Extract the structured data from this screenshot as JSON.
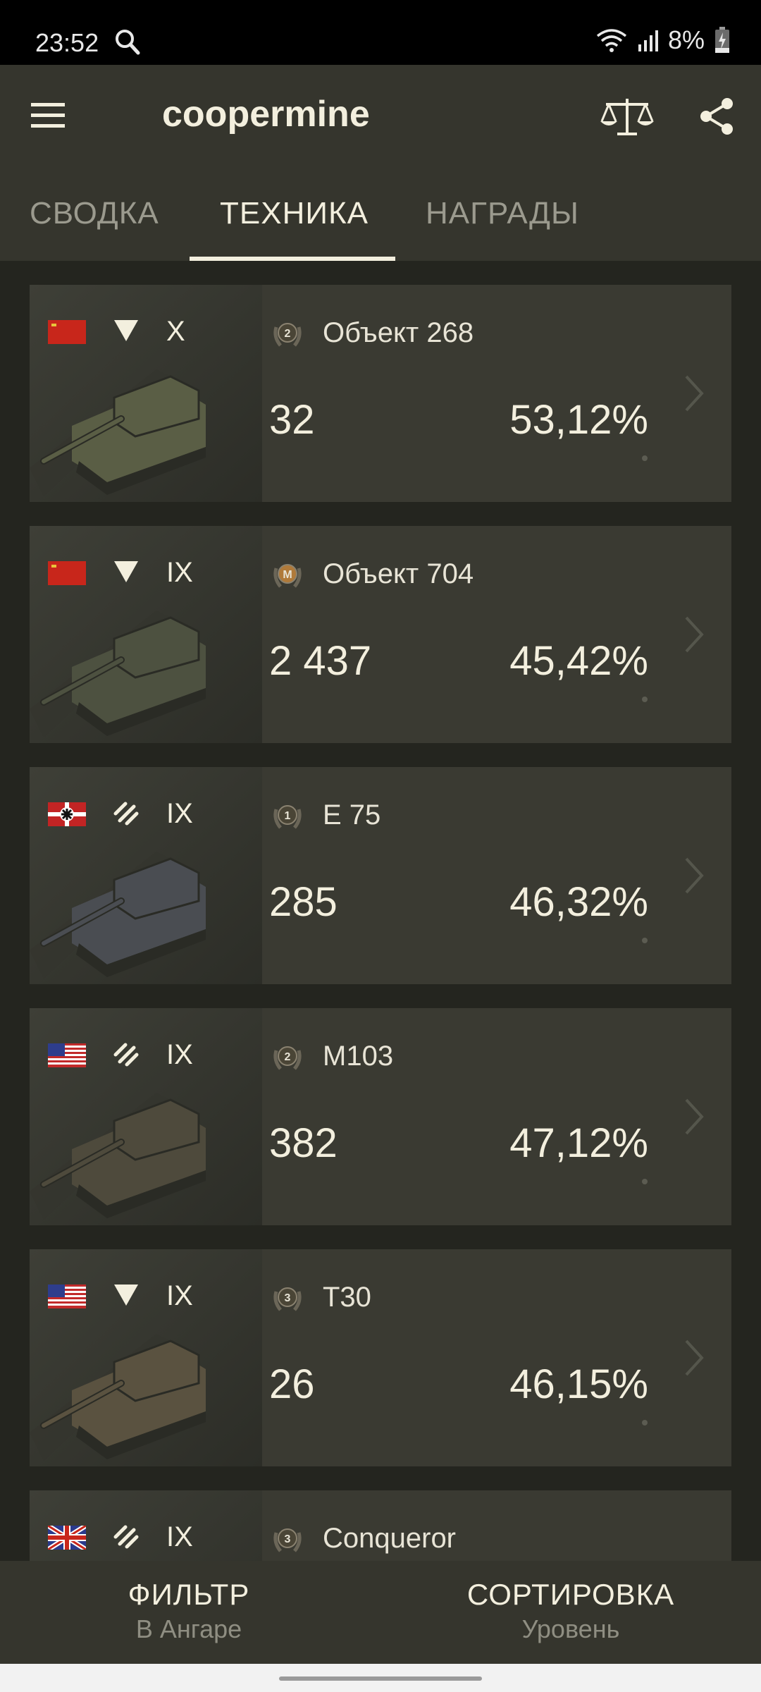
{
  "status_bar": {
    "time": "23:52",
    "battery": "8%"
  },
  "app_bar": {
    "title": "coopermine"
  },
  "tabs": [
    {
      "label": "СВОДКА",
      "active": false
    },
    {
      "label": "ТЕХНИКА",
      "active": true
    },
    {
      "label": "НАГРАДЫ",
      "active": false
    }
  ],
  "vehicles": [
    {
      "name": "Объект 268",
      "tier": "X",
      "nation": "ussr",
      "class": "td",
      "mastery": "2",
      "battles": "32",
      "winrate": "53,12%"
    },
    {
      "name": "Объект 704",
      "tier": "IX",
      "nation": "ussr",
      "class": "td",
      "mastery": "M",
      "battles": "2 437",
      "winrate": "45,42%"
    },
    {
      "name": "E 75",
      "tier": "IX",
      "nation": "germany",
      "class": "heavy",
      "mastery": "1",
      "battles": "285",
      "winrate": "46,32%"
    },
    {
      "name": "M103",
      "tier": "IX",
      "nation": "usa",
      "class": "heavy",
      "mastery": "2",
      "battles": "382",
      "winrate": "47,12%"
    },
    {
      "name": "T30",
      "tier": "IX",
      "nation": "usa",
      "class": "td",
      "mastery": "3",
      "battles": "26",
      "winrate": "46,15%"
    },
    {
      "name": "Conqueror",
      "tier": "IX",
      "nation": "uk",
      "class": "heavy",
      "mastery": "3",
      "battles": "",
      "winrate": ""
    }
  ],
  "bottom_bar": {
    "filter": {
      "label": "ФИЛЬТР",
      "value": "В Ангаре"
    },
    "sort": {
      "label": "СОРТИРОВКА",
      "value": "Уровень"
    }
  },
  "colors": {
    "background": "#24251f",
    "bar": "#35352d",
    "card": "#3a3a32",
    "text": "#f3efde",
    "muted": "#9b9a8e"
  }
}
